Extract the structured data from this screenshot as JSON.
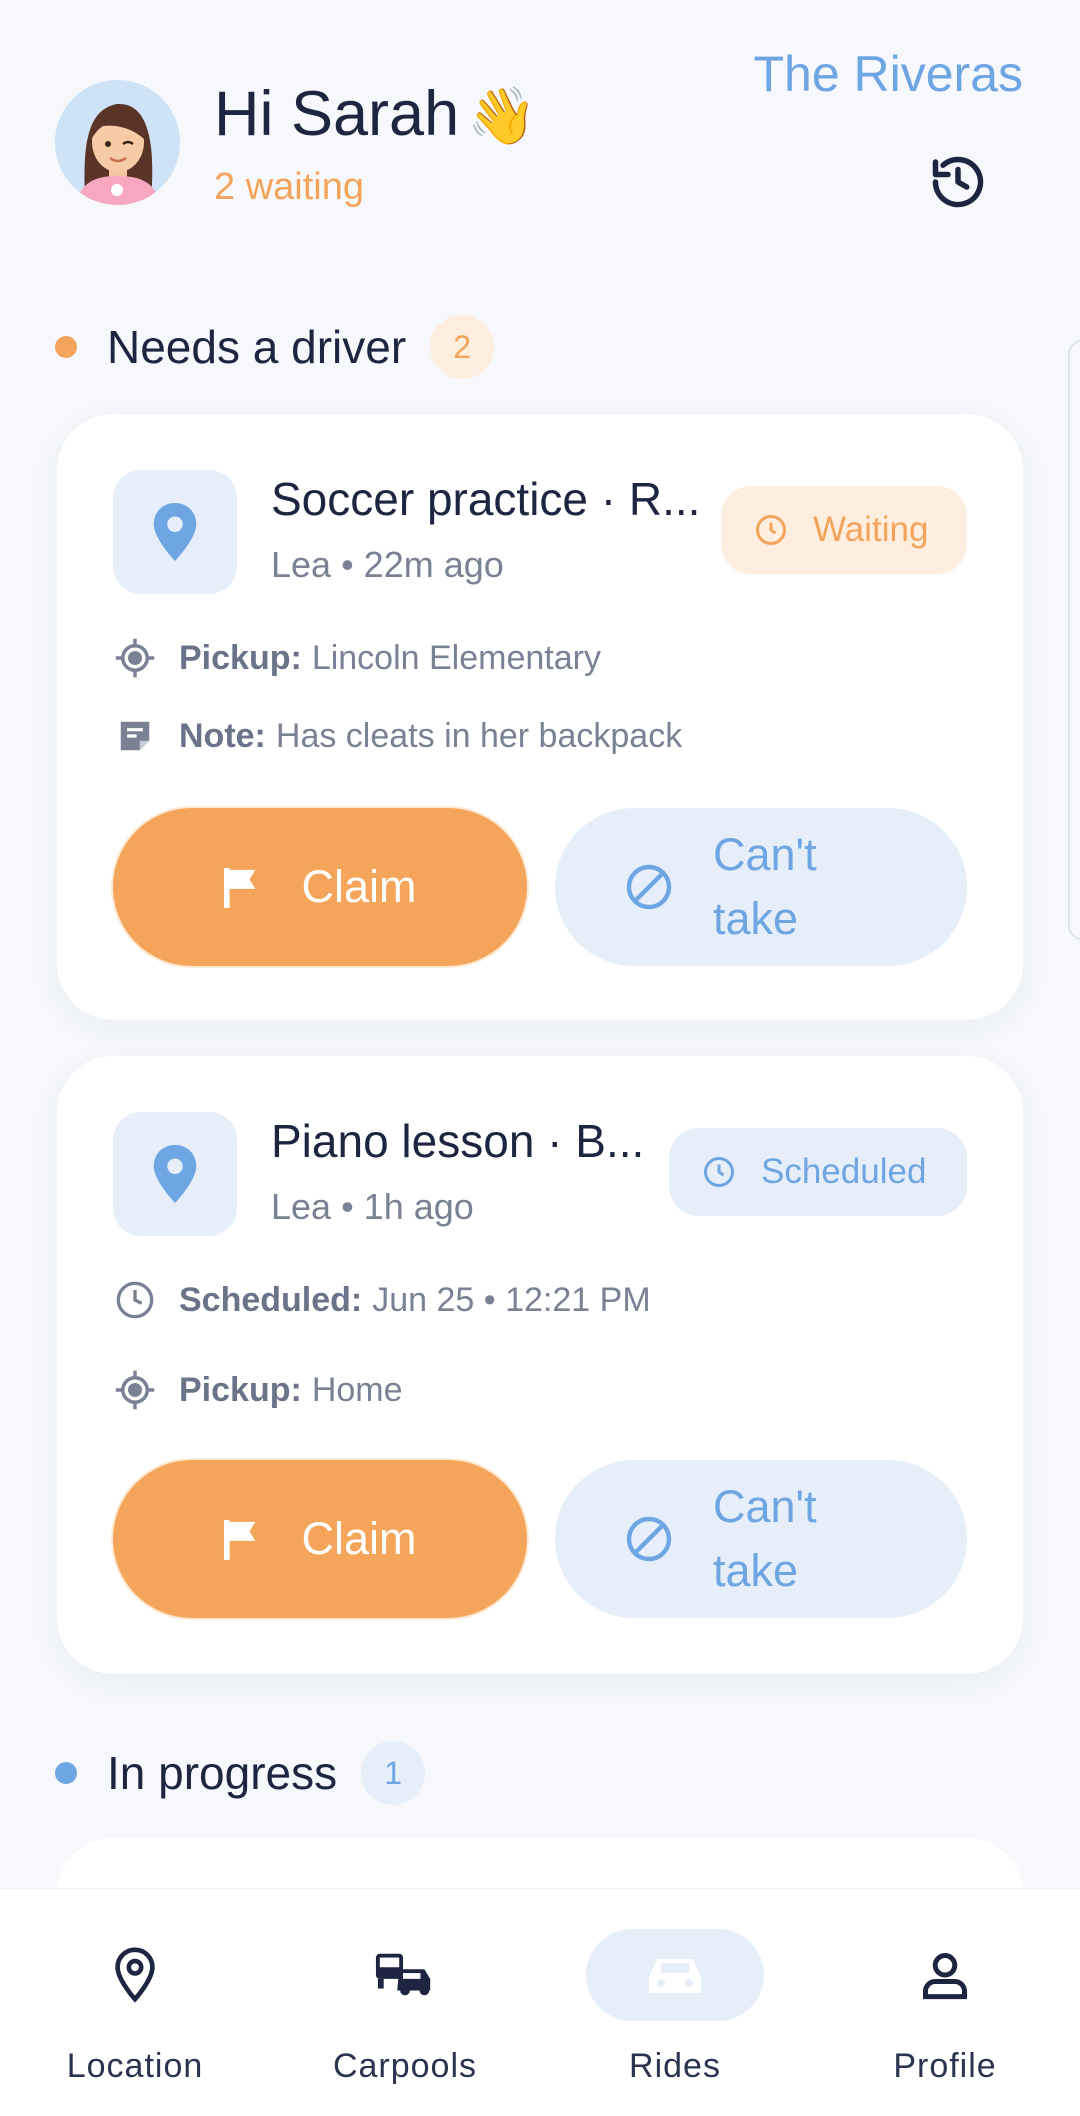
{
  "header": {
    "greeting": "Hi Sarah",
    "wave_emoji": "👋",
    "status": "2 waiting",
    "family_name": "The Riveras",
    "history_icon": "history-icon"
  },
  "sections": {
    "needs_driver": {
      "title": "Needs a driver",
      "count": "2",
      "dot_color": "#f4a45a"
    },
    "in_progress": {
      "title": "In progress",
      "count": "1",
      "dot_color": "#6ea5e3"
    }
  },
  "rides": [
    {
      "title": "Soccer practice · R...",
      "subtitle": "Lea • 22m ago",
      "badge": "Waiting",
      "rows": [
        {
          "label": "Pickup:",
          "value": "Lincoln Elementary",
          "icon": "crosshair-icon"
        },
        {
          "label": "Note:",
          "value": "Has cleats in her backpack",
          "icon": "note-icon"
        }
      ],
      "claim_label": "Claim",
      "cant_label": "Can't take"
    },
    {
      "title": "Piano lesson · B...",
      "subtitle": "Lea • 1h ago",
      "badge": "Scheduled",
      "rows": [
        {
          "label": "Scheduled:",
          "value": "Jun 25 • 12:21 PM",
          "icon": "clock-icon"
        },
        {
          "label": "Pickup:",
          "value": "Home",
          "icon": "crosshair-icon"
        }
      ],
      "claim_label": "Claim",
      "cant_label": "Can't take"
    }
  ],
  "nav": [
    {
      "label": "Location",
      "icon": "location-pin-icon",
      "active": false
    },
    {
      "label": "Carpools",
      "icon": "carpool-icon",
      "active": false
    },
    {
      "label": "Rides",
      "icon": "car-icon",
      "active": true
    },
    {
      "label": "Profile",
      "icon": "person-icon",
      "active": false
    }
  ],
  "colors": {
    "accent_orange": "#f4a55a",
    "accent_blue": "#6ea5e3",
    "badge_waiting_bg": "#fdeedf",
    "badge_scheduled_bg": "#e6eef9"
  }
}
